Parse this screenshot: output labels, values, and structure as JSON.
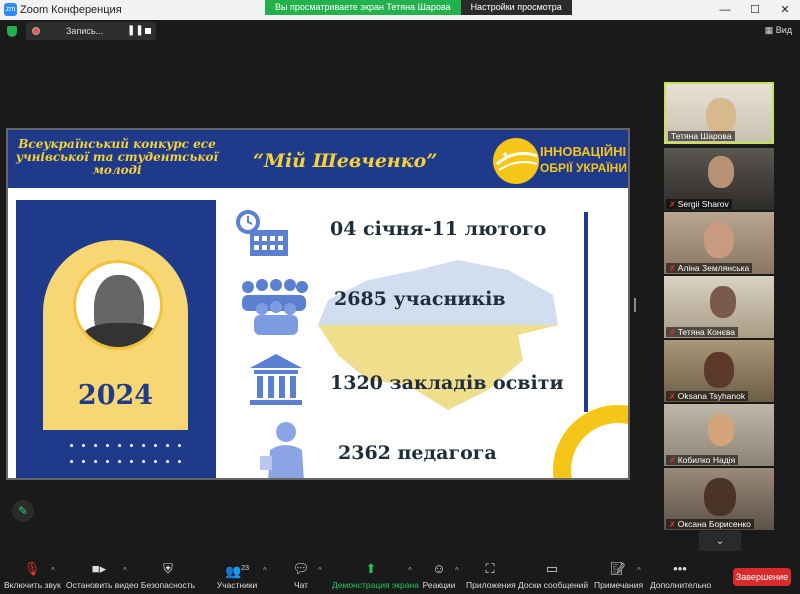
{
  "window": {
    "title": "Zoom Конференция",
    "minimize": "—",
    "maximize": "☐",
    "close": "✕"
  },
  "share_banner": {
    "message": "Вы просматриваете экран Тетяна Шарова",
    "options": "Настройки просмотра"
  },
  "recording": {
    "label": "Запись...",
    "pause": "❚❚"
  },
  "view_button": "Вид",
  "slide": {
    "left_title": "Всеукраїнський конкурс есе учнівської та студентської молоді",
    "center_title": "“Мій Шевченко”",
    "logo_line1": "ІННОВАЦІЙНІ",
    "logo_line2": "ОБРІЇ УКРАЇНИ",
    "year": "2024",
    "stats": [
      {
        "text": "04 січня-11 лютого",
        "icon": "calendar-clock-icon"
      },
      {
        "text": "2685 учасників",
        "icon": "people-group-icon"
      },
      {
        "text": "1320 закладів освіти",
        "icon": "institution-icon"
      },
      {
        "text": "2362 педагога",
        "icon": "teacher-icon"
      }
    ]
  },
  "participants": [
    {
      "name": "Тетяна Шарова",
      "muted": false,
      "active": true
    },
    {
      "name": "Sergii Sharov",
      "muted": true,
      "active": false
    },
    {
      "name": "Аліна Землянська",
      "muted": true,
      "active": false
    },
    {
      "name": "Тетяна Конєва",
      "muted": true,
      "active": false
    },
    {
      "name": "Oksana Tsyhanok",
      "muted": true,
      "active": false
    },
    {
      "name": "Кобилко Надія",
      "muted": true,
      "active": false
    },
    {
      "name": "Оксана Борисенко",
      "muted": true,
      "active": false
    }
  ],
  "toolbar": {
    "unmute": "Включить звук",
    "stop_video": "Остановить видео",
    "security": "Безопасность",
    "participants": "Участники",
    "participants_count": "23",
    "chat": "Чат",
    "share_screen": "Демонстрация экрана",
    "reactions": "Реакции",
    "apps": "Приложения",
    "whiteboards": "Доски сообщений",
    "notes": "Примечания",
    "more": "Дополнительно",
    "end": "Завершение"
  },
  "colors": {
    "slide_blue": "#1f3a8a",
    "slide_yellow": "#f5c518",
    "zoom_green": "#23b14d",
    "end_red": "#d92b2b"
  }
}
